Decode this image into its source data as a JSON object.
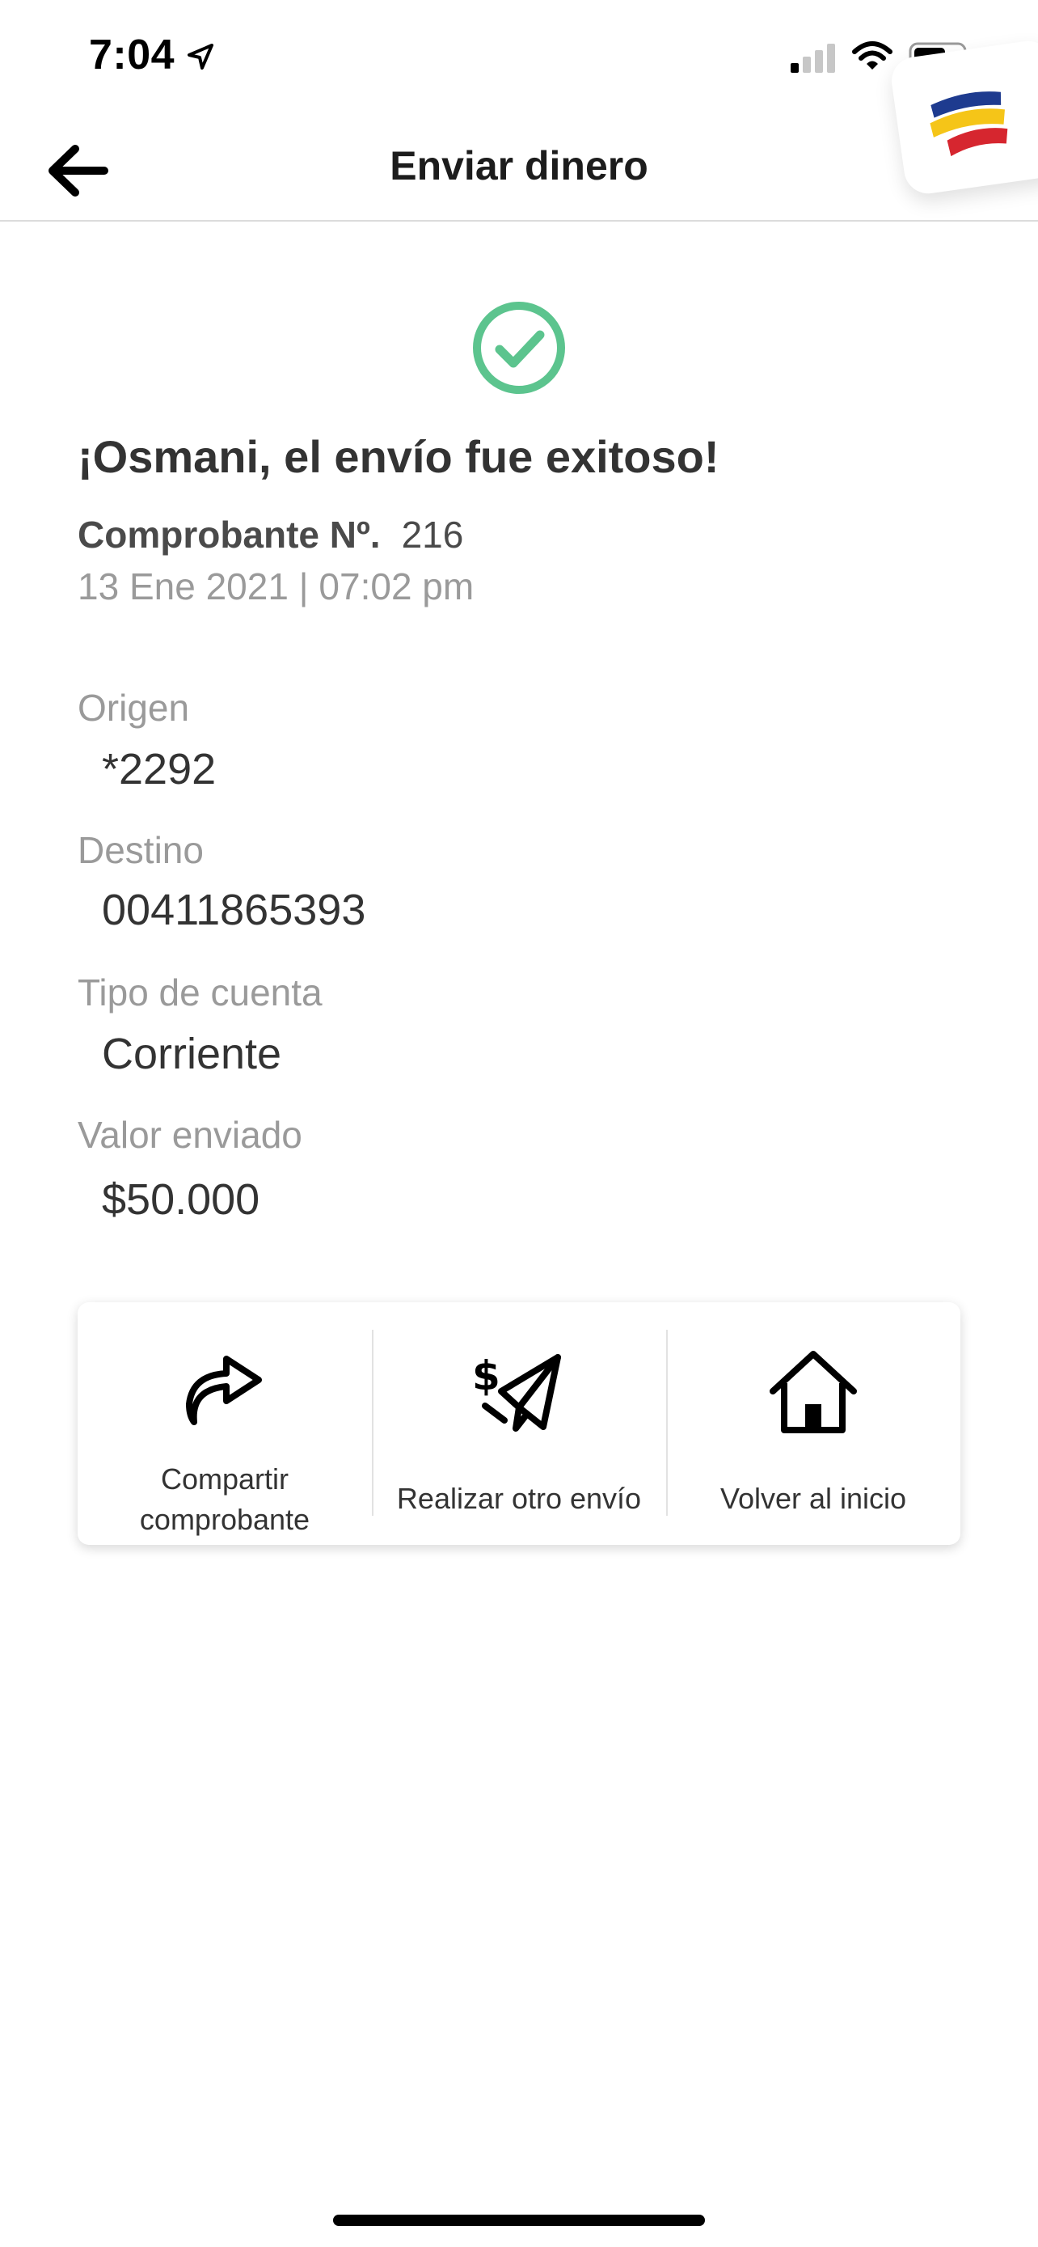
{
  "status_bar": {
    "time": "7:04",
    "icons": [
      "location-arrow-icon",
      "cellular-signal-icon",
      "wifi-icon",
      "battery-icon"
    ]
  },
  "brand": {
    "logo": "bank-flag-logo",
    "colors": [
      "#1e3b8f",
      "#f5c518",
      "#d6262f"
    ]
  },
  "header": {
    "title": "Enviar dinero",
    "back_icon": "arrow-left-icon"
  },
  "success": {
    "icon": "check-circle-icon",
    "color": "#5cc48e",
    "title": "¡Osmani, el envío fue exitoso!"
  },
  "receipt": {
    "label": "Comprobante Nº.",
    "number": "216",
    "date": "13 Ene 2021 | 07:02 pm"
  },
  "details": [
    {
      "label": "Origen",
      "value": "*2292"
    },
    {
      "label": "Destino",
      "value": "00411865393"
    },
    {
      "label": "Tipo de cuenta",
      "value": "Corriente"
    },
    {
      "label": "Valor enviado",
      "value": "$50.000"
    }
  ],
  "actions": [
    {
      "label": "Compartir comprobante",
      "icon": "share-arrow-icon"
    },
    {
      "label": "Realizar otro envío",
      "icon": "paper-plane-money-icon"
    },
    {
      "label": "Volver al inicio",
      "icon": "home-icon"
    }
  ]
}
